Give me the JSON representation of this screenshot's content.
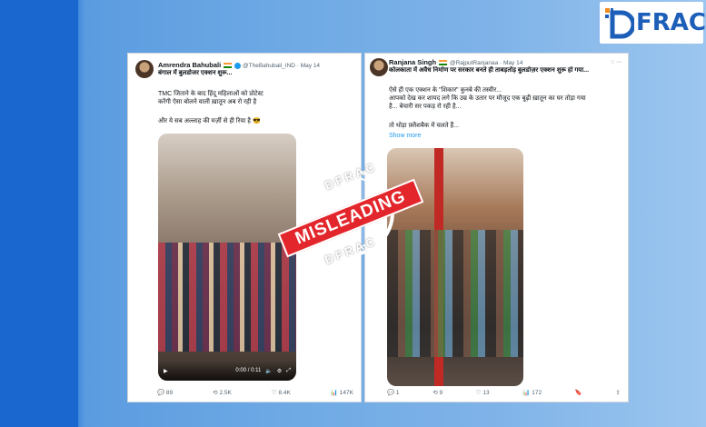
{
  "logo": {
    "text": "FRAC"
  },
  "stamp": {
    "top": "DFRAC",
    "banner": "MISLEADING",
    "bottom": "DFRAC"
  },
  "tweet1": {
    "name": "Amrendra Bahubali",
    "handle": "@TheBahubali_IND · May 14",
    "headline": "बंगाल में बुलडोजर एक्शन शुरू...",
    "body_lines": [
      "TMC जिताने के बाद हिंदू महिलाओं को प्रोटेस्ट",
      "करेंगी ऐसा बोलने वाली ख़ातून अब रो रही है",
      "",
      "और ये सब अल्लाह की मर्ज़ी से ही रिया है 😎"
    ],
    "video_time": "0:00 / 0:11",
    "replies": "89",
    "reposts": "2.5K",
    "likes": "8.4K",
    "views": "147K"
  },
  "tweet2": {
    "name": "Ranjana Singh",
    "handle": "@RajputRanjanaa · May 14",
    "headline": "कोलकाता में अवैध निर्माण पर सरकार बनते ही ताबड़तोड़ बुलडोज़र एक्शन शुरू हो गया...",
    "body_lines": [
      "ऐसे ही एक एक्शन के \"शिकार\" कुनबे की तस्वीर...",
      "आपको देख कर शायद लगे कि उम्र के उतार पर मौजूद एक बूढ़ी ख़ातून का घर तोड़ा गया",
      "है... बेचारी सर पकड़ रो रही है...",
      "",
      "तो थोड़ा फ़्लैशबैक में चलते हैं..."
    ],
    "show_more": "Show more",
    "replies": "1",
    "reposts": "9",
    "likes": "13",
    "views": "172"
  },
  "colors": {
    "accent": "#e3262b",
    "link": "#1d9bf0",
    "brand": "#1d5fb8"
  }
}
